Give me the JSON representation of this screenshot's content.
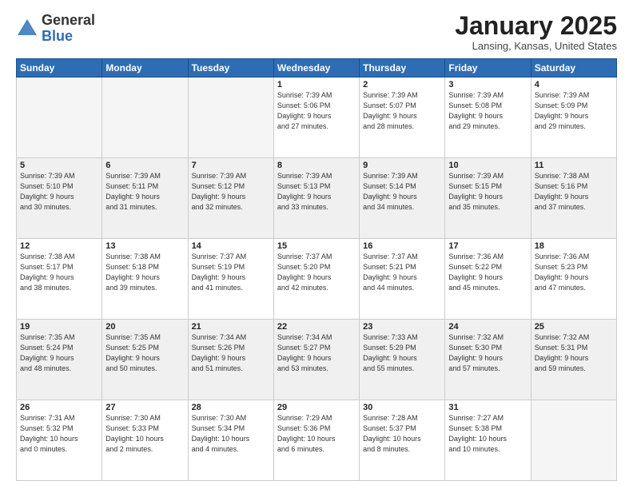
{
  "header": {
    "logo_general": "General",
    "logo_blue": "Blue",
    "month_title": "January 2025",
    "location": "Lansing, Kansas, United States"
  },
  "weekdays": [
    "Sunday",
    "Monday",
    "Tuesday",
    "Wednesday",
    "Thursday",
    "Friday",
    "Saturday"
  ],
  "weeks": [
    [
      {
        "num": "",
        "info": "",
        "empty": true
      },
      {
        "num": "",
        "info": "",
        "empty": true
      },
      {
        "num": "",
        "info": "",
        "empty": true
      },
      {
        "num": "1",
        "info": "Sunrise: 7:39 AM\nSunset: 5:06 PM\nDaylight: 9 hours\nand 27 minutes."
      },
      {
        "num": "2",
        "info": "Sunrise: 7:39 AM\nSunset: 5:07 PM\nDaylight: 9 hours\nand 28 minutes."
      },
      {
        "num": "3",
        "info": "Sunrise: 7:39 AM\nSunset: 5:08 PM\nDaylight: 9 hours\nand 29 minutes."
      },
      {
        "num": "4",
        "info": "Sunrise: 7:39 AM\nSunset: 5:09 PM\nDaylight: 9 hours\nand 29 minutes."
      }
    ],
    [
      {
        "num": "5",
        "info": "Sunrise: 7:39 AM\nSunset: 5:10 PM\nDaylight: 9 hours\nand 30 minutes.",
        "shaded": true
      },
      {
        "num": "6",
        "info": "Sunrise: 7:39 AM\nSunset: 5:11 PM\nDaylight: 9 hours\nand 31 minutes.",
        "shaded": true
      },
      {
        "num": "7",
        "info": "Sunrise: 7:39 AM\nSunset: 5:12 PM\nDaylight: 9 hours\nand 32 minutes.",
        "shaded": true
      },
      {
        "num": "8",
        "info": "Sunrise: 7:39 AM\nSunset: 5:13 PM\nDaylight: 9 hours\nand 33 minutes.",
        "shaded": true
      },
      {
        "num": "9",
        "info": "Sunrise: 7:39 AM\nSunset: 5:14 PM\nDaylight: 9 hours\nand 34 minutes.",
        "shaded": true
      },
      {
        "num": "10",
        "info": "Sunrise: 7:39 AM\nSunset: 5:15 PM\nDaylight: 9 hours\nand 35 minutes.",
        "shaded": true
      },
      {
        "num": "11",
        "info": "Sunrise: 7:38 AM\nSunset: 5:16 PM\nDaylight: 9 hours\nand 37 minutes.",
        "shaded": true
      }
    ],
    [
      {
        "num": "12",
        "info": "Sunrise: 7:38 AM\nSunset: 5:17 PM\nDaylight: 9 hours\nand 38 minutes."
      },
      {
        "num": "13",
        "info": "Sunrise: 7:38 AM\nSunset: 5:18 PM\nDaylight: 9 hours\nand 39 minutes."
      },
      {
        "num": "14",
        "info": "Sunrise: 7:37 AM\nSunset: 5:19 PM\nDaylight: 9 hours\nand 41 minutes."
      },
      {
        "num": "15",
        "info": "Sunrise: 7:37 AM\nSunset: 5:20 PM\nDaylight: 9 hours\nand 42 minutes."
      },
      {
        "num": "16",
        "info": "Sunrise: 7:37 AM\nSunset: 5:21 PM\nDaylight: 9 hours\nand 44 minutes."
      },
      {
        "num": "17",
        "info": "Sunrise: 7:36 AM\nSunset: 5:22 PM\nDaylight: 9 hours\nand 45 minutes."
      },
      {
        "num": "18",
        "info": "Sunrise: 7:36 AM\nSunset: 5:23 PM\nDaylight: 9 hours\nand 47 minutes."
      }
    ],
    [
      {
        "num": "19",
        "info": "Sunrise: 7:35 AM\nSunset: 5:24 PM\nDaylight: 9 hours\nand 48 minutes.",
        "shaded": true
      },
      {
        "num": "20",
        "info": "Sunrise: 7:35 AM\nSunset: 5:25 PM\nDaylight: 9 hours\nand 50 minutes.",
        "shaded": true
      },
      {
        "num": "21",
        "info": "Sunrise: 7:34 AM\nSunset: 5:26 PM\nDaylight: 9 hours\nand 51 minutes.",
        "shaded": true
      },
      {
        "num": "22",
        "info": "Sunrise: 7:34 AM\nSunset: 5:27 PM\nDaylight: 9 hours\nand 53 minutes.",
        "shaded": true
      },
      {
        "num": "23",
        "info": "Sunrise: 7:33 AM\nSunset: 5:29 PM\nDaylight: 9 hours\nand 55 minutes.",
        "shaded": true
      },
      {
        "num": "24",
        "info": "Sunrise: 7:32 AM\nSunset: 5:30 PM\nDaylight: 9 hours\nand 57 minutes.",
        "shaded": true
      },
      {
        "num": "25",
        "info": "Sunrise: 7:32 AM\nSunset: 5:31 PM\nDaylight: 9 hours\nand 59 minutes.",
        "shaded": true
      }
    ],
    [
      {
        "num": "26",
        "info": "Sunrise: 7:31 AM\nSunset: 5:32 PM\nDaylight: 10 hours\nand 0 minutes."
      },
      {
        "num": "27",
        "info": "Sunrise: 7:30 AM\nSunset: 5:33 PM\nDaylight: 10 hours\nand 2 minutes."
      },
      {
        "num": "28",
        "info": "Sunrise: 7:30 AM\nSunset: 5:34 PM\nDaylight: 10 hours\nand 4 minutes."
      },
      {
        "num": "29",
        "info": "Sunrise: 7:29 AM\nSunset: 5:36 PM\nDaylight: 10 hours\nand 6 minutes."
      },
      {
        "num": "30",
        "info": "Sunrise: 7:28 AM\nSunset: 5:37 PM\nDaylight: 10 hours\nand 8 minutes."
      },
      {
        "num": "31",
        "info": "Sunrise: 7:27 AM\nSunset: 5:38 PM\nDaylight: 10 hours\nand 10 minutes."
      },
      {
        "num": "",
        "info": "",
        "empty": true
      }
    ]
  ]
}
